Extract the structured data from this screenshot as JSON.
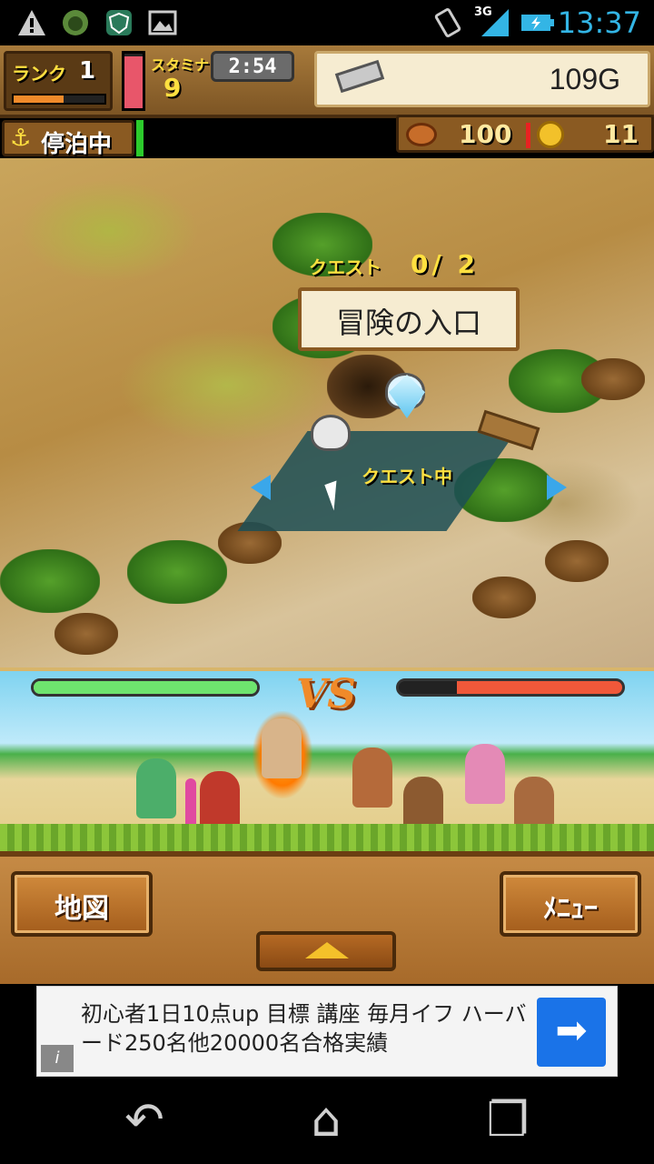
{
  "status_bar": {
    "time": "13:37",
    "network": "3G",
    "icons": [
      "warning-icon",
      "headset-app-icon",
      "shield-app-icon",
      "image-icon",
      "vibrate-icon",
      "signal-icon",
      "battery-charging-icon"
    ]
  },
  "hud": {
    "rank_label": "ランク",
    "rank_value": "1",
    "rank_progress": 0.55,
    "stamina_label": "スタミナ",
    "stamina_value": "9",
    "stamina_fill": 0.95,
    "timer": "2:54",
    "money": "109G",
    "money_icon": "silver-bar-icon"
  },
  "status_row": {
    "docked_icon": "anchor-icon",
    "docked_text": "停泊中",
    "food_icon": "meat-icon",
    "food_value": "100",
    "coin_icon": "gold-coin-icon",
    "coin_value": "11"
  },
  "map": {
    "quest_counter_label": "クエスト",
    "quest_counter_value": "0/ 2",
    "quest_name": "冒険の入口",
    "quest_status": "クエスト中"
  },
  "battle": {
    "vs_label": "VS",
    "player_hp": 1.0,
    "enemy_hp": 0.74
  },
  "panel": {
    "map_button": "地図",
    "menu_button": "ﾒﾆｭｰ"
  },
  "ad": {
    "text": "初心者1日10点up 目標 講座 毎月イフ ハーバード250名他20000名合格実績",
    "info_icon": "i",
    "arrow": "➡"
  },
  "nav": {
    "back": "↶",
    "home": "⌂",
    "recent": "❐"
  },
  "colors": {
    "status_time": "#33b5e5",
    "hp_player": "#6ee36e",
    "hp_enemy": "#f0583a",
    "vs": "#f08a2a",
    "ad_button": "#1a73e8"
  }
}
